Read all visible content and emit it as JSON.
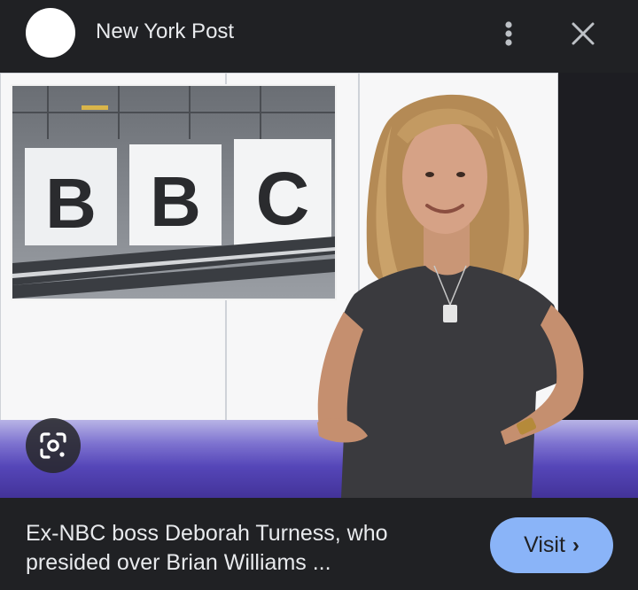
{
  "header": {
    "source_name": "New York Post"
  },
  "image": {
    "inset_letters": [
      "B",
      "B",
      "C"
    ]
  },
  "footer": {
    "caption_line1": "Ex-NBC boss Deborah Turness, who",
    "caption_line2": "presided over Brian Williams ...",
    "visit_label": "Visit",
    "visit_chevron": "›"
  },
  "icons": {
    "more": "more-vert-icon",
    "close": "close-icon",
    "lens": "google-lens-icon"
  },
  "colors": {
    "background": "#202124",
    "text": "#e8eaed",
    "visit_button": "#8ab4f8"
  }
}
